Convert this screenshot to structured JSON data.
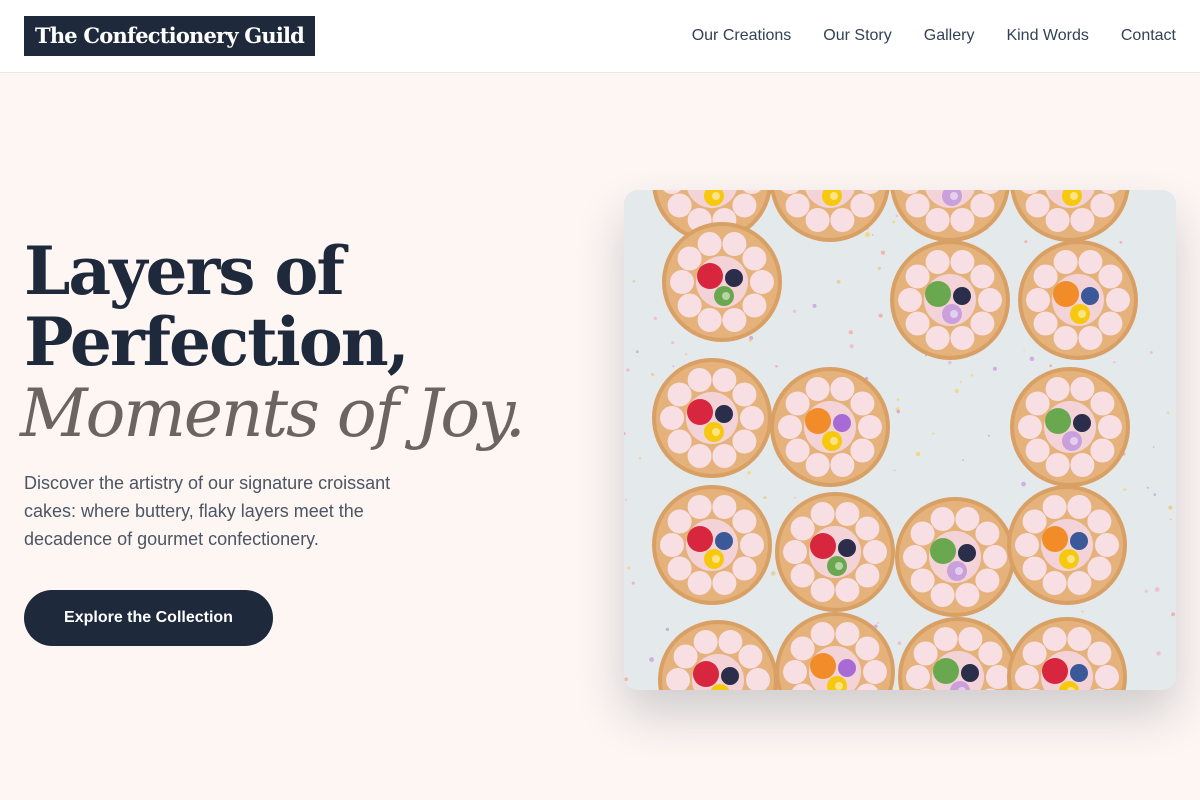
{
  "brand": {
    "logo_text": "The Confectionery Guild"
  },
  "nav": {
    "items": [
      {
        "label": "Our Creations"
      },
      {
        "label": "Our Story"
      },
      {
        "label": "Gallery"
      },
      {
        "label": "Kind Words"
      },
      {
        "label": "Contact"
      }
    ]
  },
  "hero": {
    "headline_line1": "Layers of",
    "headline_line2": "Perfection,",
    "headline_accent": "Moments of Joy.",
    "description": "Discover the artistry of our signature croissant cakes: where buttery, flaky layers meet the decadence of gourmet confectionery.",
    "cta_label": "Explore the Collection",
    "image_subject": "overhead view of fruit-topped pastry tarts"
  },
  "colors": {
    "background": "#fdf6f3",
    "navy": "#1e293b",
    "accent_text": "#6b6461"
  }
}
